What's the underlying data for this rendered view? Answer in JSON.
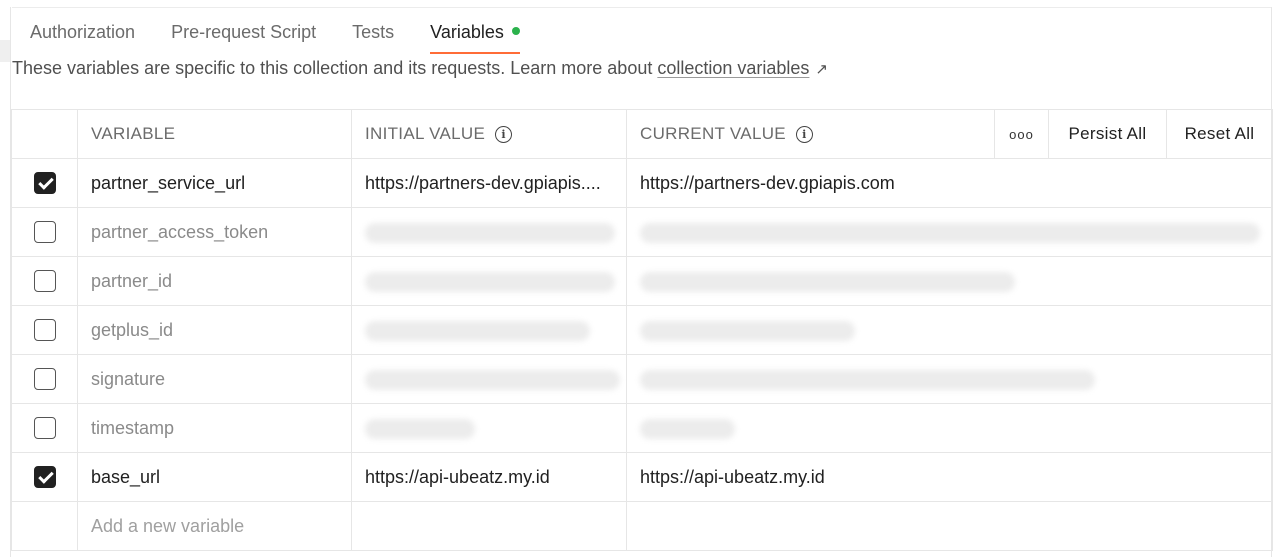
{
  "tabs": [
    {
      "label": "Authorization"
    },
    {
      "label": "Pre-request Script"
    },
    {
      "label": "Tests"
    },
    {
      "label": "Variables",
      "active": true
    }
  ],
  "description": {
    "text": "These variables are specific to this collection and its requests. Learn more about ",
    "link": "collection variables"
  },
  "table": {
    "headers": {
      "variable": "VARIABLE",
      "initial": "INITIAL VALUE",
      "current": "CURRENT VALUE",
      "persist_all": "Persist All",
      "reset_all": "Reset All"
    },
    "rows": [
      {
        "name": "partner_service_url",
        "initial": "https://partners-dev.gpiapis....",
        "current": "https://partners-dev.gpiapis.com",
        "enabled": true
      },
      {
        "name": "partner_access_token",
        "initial": "",
        "current": "",
        "enabled": false
      },
      {
        "name": "partner_id",
        "initial": "",
        "current": "",
        "enabled": false
      },
      {
        "name": "getplus_id",
        "initial": "",
        "current": "",
        "enabled": false
      },
      {
        "name": "signature",
        "initial": "",
        "current": "",
        "enabled": false
      },
      {
        "name": "timestamp",
        "initial": "",
        "current": "",
        "enabled": false
      },
      {
        "name": "base_url",
        "initial": "https://api-ubeatz.my.id",
        "current": "https://api-ubeatz.my.id",
        "enabled": true
      }
    ],
    "add_placeholder": "Add a new variable"
  },
  "colors": {
    "active_tab_underline": "#ff6c37",
    "unsaved_dot": "#2bb24c",
    "checkbox_checked": "#212121"
  },
  "icons": {
    "info": "info-circle-icon",
    "more": "more-horizontal-icon",
    "external_link": "external-link-arrow-icon"
  }
}
